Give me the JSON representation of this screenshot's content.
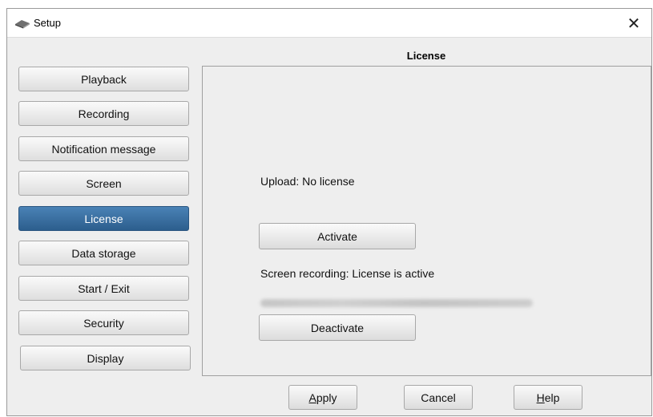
{
  "window": {
    "title": "Setup",
    "close_glyph": "✕"
  },
  "sidebar": {
    "items": [
      {
        "label": "Playback",
        "active": false
      },
      {
        "label": "Recording",
        "active": false
      },
      {
        "label": "Notification message",
        "active": false
      },
      {
        "label": "Screen",
        "active": false
      },
      {
        "label": "License",
        "active": true
      },
      {
        "label": "Data storage",
        "active": false
      },
      {
        "label": "Start / Exit",
        "active": false
      },
      {
        "label": "Security",
        "active": false
      },
      {
        "label": "Display",
        "active": false
      }
    ]
  },
  "panel": {
    "title": "License",
    "upload_status": "Upload: No license",
    "activate_label": "Activate",
    "screen_recording_status": "Screen recording: License is active",
    "deactivate_label": "Deactivate"
  },
  "footer": {
    "apply_mnemonic": "A",
    "apply_rest": "pply",
    "cancel_label": "Cancel",
    "help_mnemonic": "H",
    "help_rest": "elp"
  },
  "colors": {
    "active_item": "#2c5e8d",
    "window_bg": "#eeeeee"
  },
  "icons": {
    "app": "setup-app-icon",
    "close": "close-icon"
  }
}
